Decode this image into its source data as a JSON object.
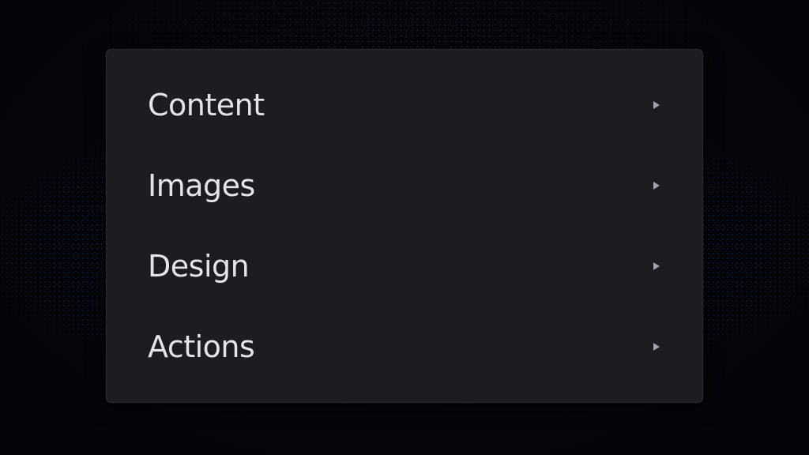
{
  "menu": {
    "items": [
      {
        "label": "Content",
        "icon": "chevron-right-icon"
      },
      {
        "label": "Images",
        "icon": "chevron-right-icon"
      },
      {
        "label": "Design",
        "icon": "chevron-right-icon"
      },
      {
        "label": "Actions",
        "icon": "chevron-right-icon"
      }
    ]
  },
  "colors": {
    "background": "#05060b",
    "menu_bg": "#1c1d21",
    "text": "#e3e4e7",
    "accent_dots": "#286edc"
  }
}
